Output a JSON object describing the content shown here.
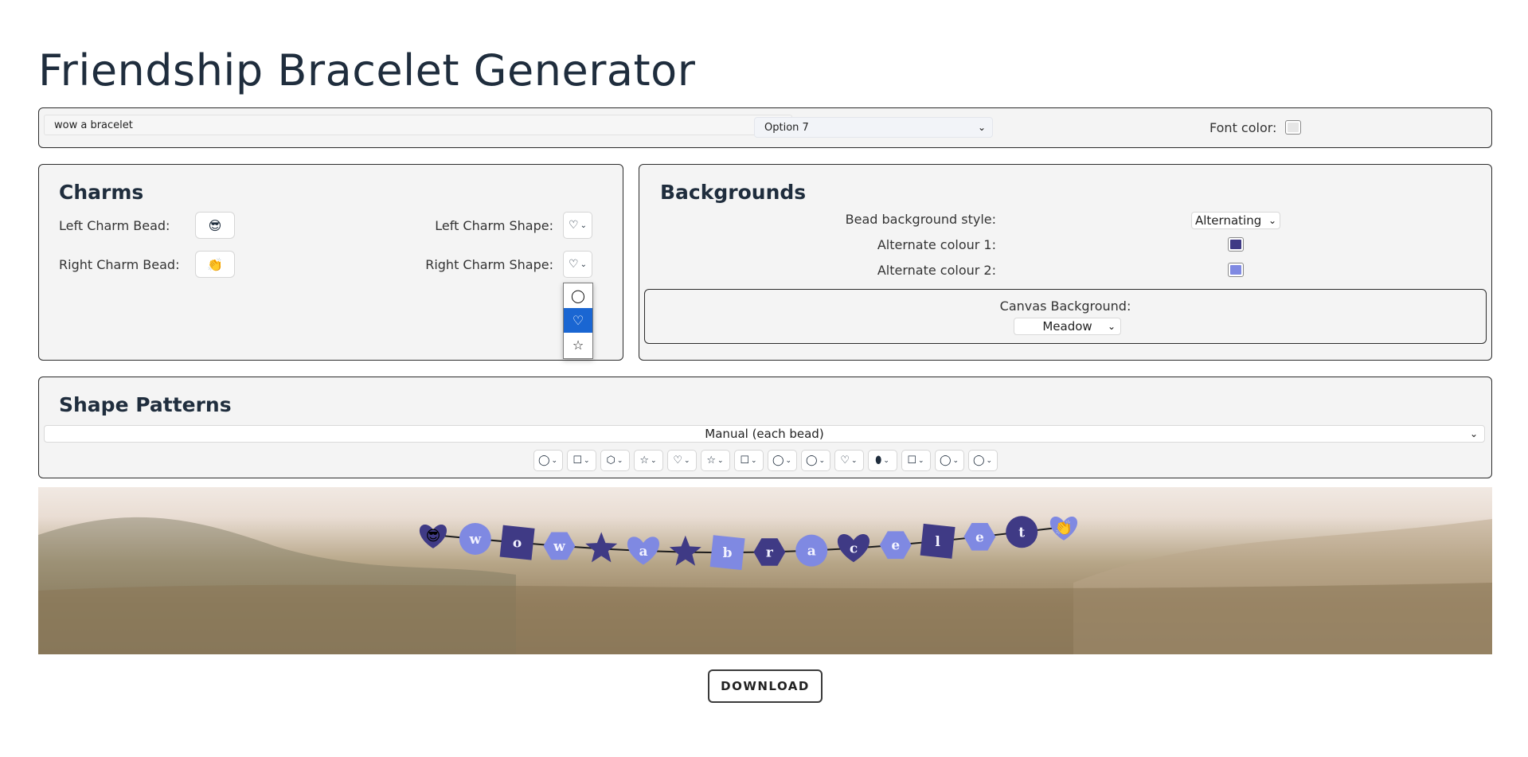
{
  "title": "Friendship Bracelet Generator",
  "topbar": {
    "text_value": "wow a bracelet",
    "option_value": "Option 7",
    "font_color_label": "Font color:",
    "font_color": "#e6e6e6"
  },
  "charms": {
    "heading": "Charms",
    "left_bead_label": "Left Charm Bead:",
    "left_bead_emoji": "😎",
    "right_bead_label": "Right Charm Bead:",
    "right_bead_emoji": "👏",
    "left_shape_label": "Left Charm Shape:",
    "left_shape_value": "♡",
    "right_shape_label": "Right Charm Shape:",
    "right_shape_value": "♡",
    "shape_options": [
      "◯",
      "♡",
      "☆"
    ],
    "selected_option": "♡"
  },
  "backgrounds": {
    "heading": "Backgrounds",
    "style_label": "Bead background style:",
    "style_value": "Alternating",
    "alt1_label": "Alternate colour 1:",
    "alt1_color": "#3f3a85",
    "alt2_label": "Alternate colour 2:",
    "alt2_color": "#7f89e2",
    "canvas_label": "Canvas Background:",
    "canvas_value": "Meadow"
  },
  "patterns": {
    "heading": "Shape Patterns",
    "mode_value": "Manual (each bead)",
    "bead_shapes": [
      "◯",
      "☐",
      "⬡",
      "☆",
      "♡",
      "☆",
      "☐",
      "◯",
      "◯",
      "♡",
      "⬮",
      "☐",
      "◯",
      "◯"
    ]
  },
  "bracelet": {
    "left_charm": "😎",
    "right_charm": "👏",
    "beads": [
      {
        "letter": "w",
        "shape": "circle",
        "color": "#7f89e2"
      },
      {
        "letter": "o",
        "shape": "square",
        "color": "#3f3a85"
      },
      {
        "letter": "w",
        "shape": "hexagon",
        "color": "#7f89e2"
      },
      {
        "letter": "",
        "shape": "star",
        "color": "#3f3a85"
      },
      {
        "letter": "a",
        "shape": "heart",
        "color": "#7f89e2"
      },
      {
        "letter": "",
        "shape": "star",
        "color": "#3f3a85"
      },
      {
        "letter": "b",
        "shape": "square",
        "color": "#7f89e2"
      },
      {
        "letter": "r",
        "shape": "hexagon",
        "color": "#3f3a85"
      },
      {
        "letter": "a",
        "shape": "circle",
        "color": "#7f89e2"
      },
      {
        "letter": "c",
        "shape": "heart",
        "color": "#3f3a85"
      },
      {
        "letter": "e",
        "shape": "hexagon",
        "color": "#7f89e2"
      },
      {
        "letter": "l",
        "shape": "square",
        "color": "#3f3a85"
      },
      {
        "letter": "e",
        "shape": "hexagon",
        "color": "#7f89e2"
      },
      {
        "letter": "t",
        "shape": "circle",
        "color": "#3f3a85"
      }
    ]
  },
  "download_label": "DOWNLOAD"
}
